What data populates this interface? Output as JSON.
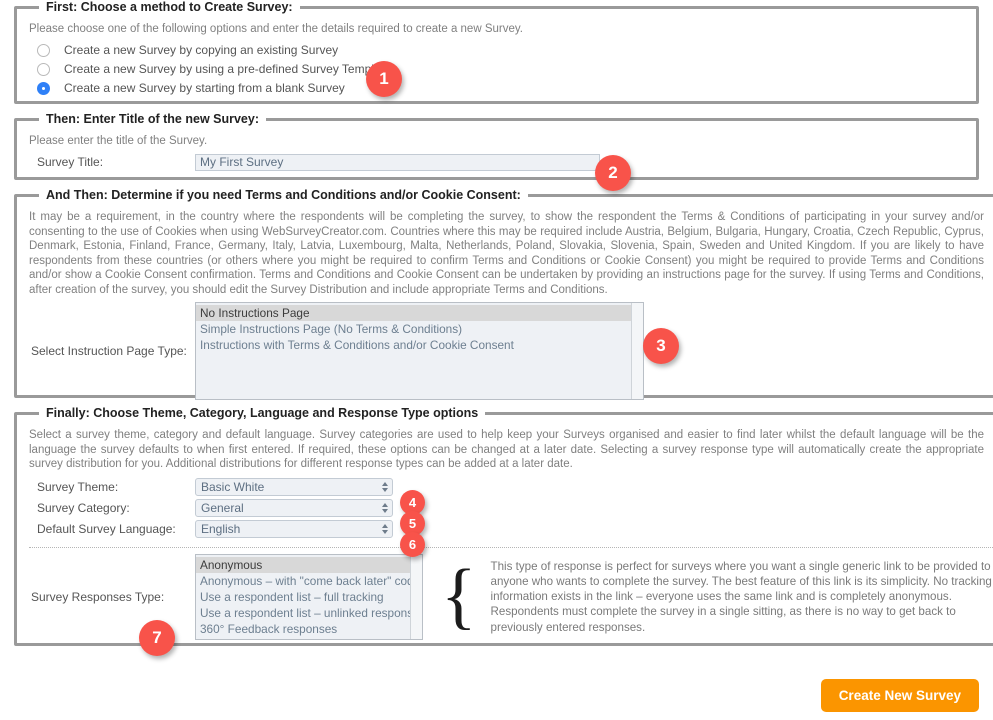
{
  "badge_color": "#F8534A",
  "accent_button_color": "#FB9500",
  "radio_selected_color": "#2F80F7",
  "sections": {
    "method": {
      "legend": "First: Choose a method to Create Survey:",
      "description": "Please choose one of the following options and enter the details required to create a new Survey.",
      "badge": "1",
      "options": [
        {
          "label": "Create a new Survey by copying an existing Survey",
          "selected": false
        },
        {
          "label": "Create a new Survey by using a pre-defined Survey Template",
          "selected": false
        },
        {
          "label": "Create a new Survey by starting from a blank Survey",
          "selected": true
        }
      ]
    },
    "title": {
      "legend": "Then: Enter Title of the new Survey:",
      "description": "Please enter the title of the Survey.",
      "badge": "2",
      "field_label": "Survey Title:",
      "field_value": "My First Survey",
      "field_placeholder": "My First Survey"
    },
    "terms": {
      "legend": "And Then: Determine if you need Terms and Conditions and/or Cookie Consent:",
      "description": "It may be a requirement, in the country where the respondents will be completing the survey, to show the respondent the Terms & Conditions of participating in your survey and/or consenting to the use of Cookies when using WebSurveyCreator.com. Countries where this may be required include Austria, Belgium, Bulgaria, Hungary, Croatia, Czech Republic, Cyprus, Denmark, Estonia, Finland, France, Germany, Italy, Latvia, Luxembourg, Malta, Netherlands, Poland, Slovakia, Slovenia, Spain, Sweden and United Kingdom. If you are likely to have respondents from these countries (or others where you might be required to confirm Terms and Conditions or Cookie Consent) you might be required to provide Terms and Conditions and/or show a Cookie Consent confirmation. Terms and Conditions and Cookie Consent can be undertaken by providing an instructions page for the survey. If using Terms and Conditions, after creation of the survey, you should edit the Survey Distribution and include appropriate Terms and Conditions.",
      "badge": "3",
      "field_label": "Select Instruction Page Type:",
      "options": [
        {
          "label": "No Instructions Page",
          "selected": true
        },
        {
          "label": "Simple Instructions Page (No Terms & Conditions)",
          "selected": false
        },
        {
          "label": "Instructions with Terms & Conditions and/or Cookie Consent",
          "selected": false
        }
      ]
    },
    "options": {
      "legend": "Finally: Choose Theme, Category, Language and Response Type options",
      "description": "Select a survey theme, category and default language. Survey categories are used to help keep your Surveys organised and easier to find later whilst the default language will be the language the survey defaults to when first entered. If required, these options can be changed at a later date. Selecting a survey response type will automatically create the appropriate survey distribution for you. Additional distributions for different response types can be added at a later date.",
      "selects": [
        {
          "label": "Survey Theme:",
          "value": "Basic White",
          "badge": "4"
        },
        {
          "label": "Survey Category:",
          "value": "General",
          "badge": "5"
        },
        {
          "label": "Default Survey Language:",
          "value": "English",
          "badge": "6"
        }
      ],
      "responses": {
        "badge": "7",
        "field_label": "Survey Responses Type:",
        "options": [
          {
            "label": "Anonymous",
            "selected": true
          },
          {
            "label": "Anonymous – with \"come back later\" code",
            "selected": false
          },
          {
            "label": "Use a respondent list – full tracking",
            "selected": false
          },
          {
            "label": "Use a respondent list – unlinked responses",
            "selected": false
          },
          {
            "label": "360° Feedback responses",
            "selected": false
          }
        ],
        "brace_glyph": "{",
        "description": "This type of response is perfect for surveys where you want a single generic link to be provided to anyone who wants to complete the survey. The best feature of this link is its simplicity. No tracking information exists in the link – everyone uses the same link and is completely anonymous. Respondents must complete the survey in a single sitting, as there is no way to get back to previously entered responses."
      }
    }
  },
  "footer": {
    "create_button": "Create New Survey"
  }
}
